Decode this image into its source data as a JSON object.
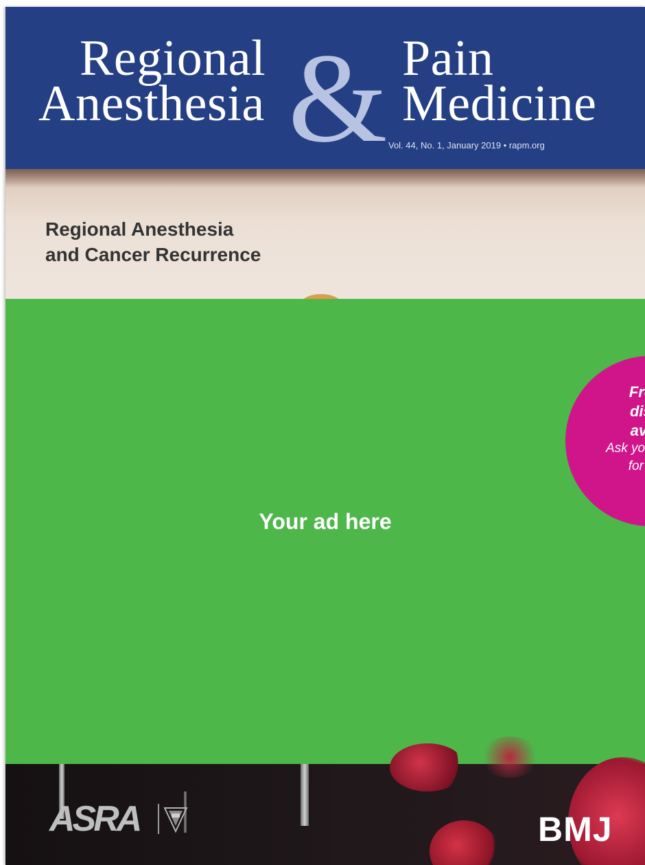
{
  "masthead": {
    "line1_left": "Regional",
    "line1_right": "Pain",
    "line2_left": "Anesthesia",
    "line2_right": "Medicine",
    "ampersand": "&",
    "issue": "Vol. 44, No. 1, January 2019 • rapm.org"
  },
  "cover": {
    "headline_line1": "Regional Anesthesia",
    "headline_line2": "and Cancer Recurrence"
  },
  "ad": {
    "text": "Your ad here",
    "badge_line1": "Free",
    "badge_line2": "disc",
    "badge_line3": "avai",
    "badge_line4": "Ask your",
    "badge_line5": "for de"
  },
  "footer": {
    "asra_logo": "ASRA",
    "bmj_logo": "BMJ"
  },
  "colors": {
    "masthead_blue": "#243f84",
    "ad_green": "#4db74a",
    "badge_magenta": "#d0158b"
  }
}
